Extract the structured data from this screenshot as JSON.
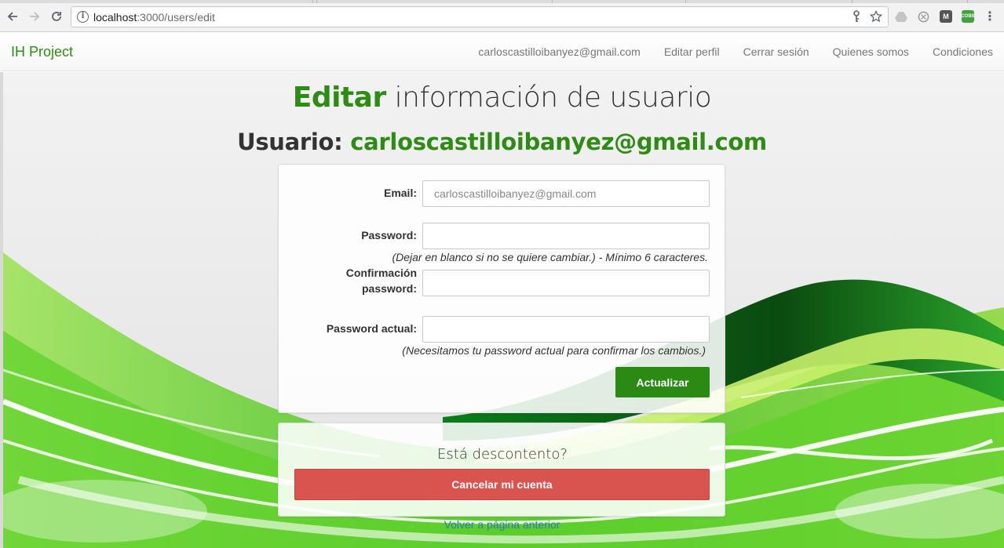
{
  "browser": {
    "url_host": "localhost",
    "url_path": ":3000/users/edit"
  },
  "navbar": {
    "brand": "IH Project",
    "links": [
      "carloscastilloibanyez@gmail.com",
      "Editar perfil",
      "Cerrar sesión",
      "Quienes somos",
      "Condiciones"
    ]
  },
  "page": {
    "title_accent": "Editar",
    "title_rest": " información de usuario",
    "subtitle_prefix": "Usuario: ",
    "subtitle_email": "carloscastilloibanyez@gmail.com"
  },
  "form": {
    "email_label": "Email:",
    "email_value": "carloscastilloibanyez@gmail.com",
    "password_label": "Password:",
    "password_value": "",
    "password_help": "(Dejar en blanco si no se quiere cambiar.) - Mínimo 6 caracteres.",
    "confirm_label_line1": "Confirmación",
    "confirm_label_line2": "password:",
    "confirm_value": "",
    "current_label": "Password actual:",
    "current_value": "",
    "current_help": "(Necesitamos tu password actual para confirmar los cambios.)",
    "submit_label": "Actualizar"
  },
  "cancel": {
    "question": "Está descontento?",
    "button_label": "Cancelar mi cuenta"
  },
  "back_link": "Volver a página anterior",
  "colors": {
    "brand_green": "#2e8b14",
    "button_green": "#2b8a13",
    "danger_red": "#d9534f",
    "link_blue": "#337ab7"
  },
  "icons": {
    "back": "arrow-left-icon",
    "forward": "arrow-right-icon",
    "reload": "reload-icon",
    "info": "info-icon",
    "key": "key-icon",
    "star": "star-icon",
    "menu": "kebab-menu-icon"
  }
}
